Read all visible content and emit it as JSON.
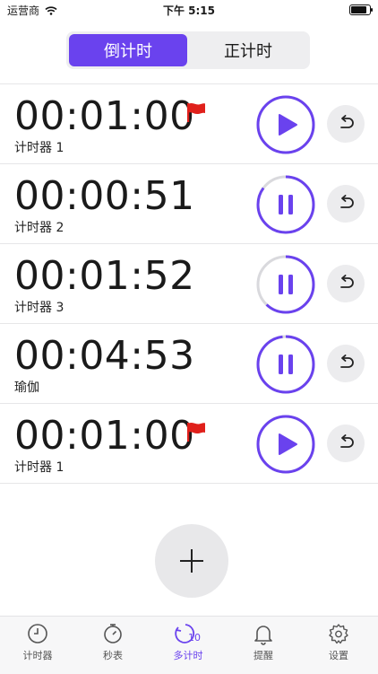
{
  "status_bar": {
    "carrier": "运营商",
    "time": "下午 5:15",
    "battery_percent": 95
  },
  "segment": {
    "countdown_label": "倒计时",
    "countup_label": "正计时",
    "selected": "倒计时"
  },
  "timers": [
    {
      "time": "00:01:00",
      "name": "计时器 1",
      "state": "play",
      "flag": true,
      "progress": 1.0
    },
    {
      "time": "00:00:51",
      "name": "计时器 2",
      "state": "pause",
      "flag": false,
      "progress": 0.85
    },
    {
      "time": "00:01:52",
      "name": "计时器 3",
      "state": "pause",
      "flag": false,
      "progress": 0.62
    },
    {
      "time": "00:04:53",
      "name": "瑜伽",
      "state": "pause",
      "flag": false,
      "progress": 0.98
    },
    {
      "time": "00:01:00",
      "name": "计时器 1",
      "state": "play",
      "flag": true,
      "progress": 1.0
    }
  ],
  "add_button_icon": "plus-icon",
  "tabbar": {
    "items": [
      {
        "label": "计时器",
        "icon": "clock-icon"
      },
      {
        "label": "秒表",
        "icon": "stopwatch-icon"
      },
      {
        "label": "多计时",
        "icon": "multi-timer-icon",
        "badge": "10",
        "active": true
      },
      {
        "label": "提醒",
        "icon": "bell-icon"
      },
      {
        "label": "设置",
        "icon": "gear-icon"
      }
    ]
  },
  "colors": {
    "accent": "#6a42ee",
    "flag": "#e0201b",
    "ring_track": "#d9d9dd"
  }
}
